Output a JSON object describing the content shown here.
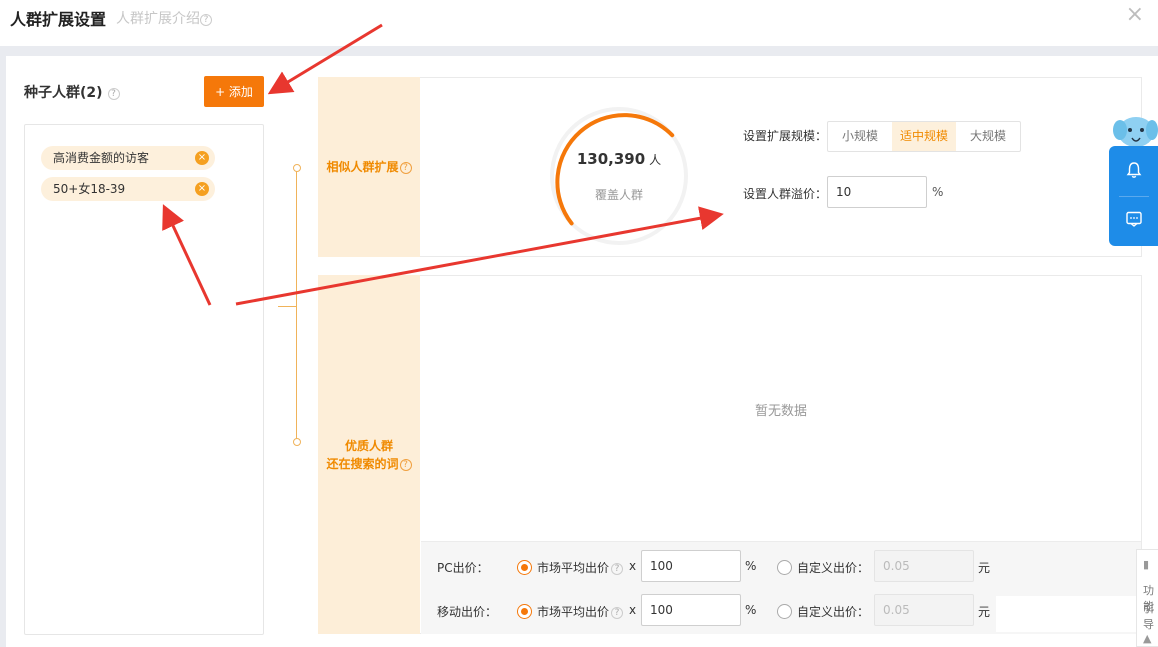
{
  "header": {
    "title": "人群扩展设置",
    "subtitle": "人群扩展介绍",
    "close": "×"
  },
  "seed": {
    "title": "种子人群(2)",
    "add_button": "+ 添加",
    "tags": [
      {
        "label": "高消费金额的访客"
      },
      {
        "label": "50+女18-39"
      }
    ]
  },
  "similar": {
    "label": "相似人群扩展",
    "count": "130,390",
    "count_unit": "人",
    "count_label": "覆盖人群",
    "scale_label": "设置扩展规模：",
    "scale_options": [
      "小规模",
      "适中规模",
      "大规模"
    ],
    "scale_selected": "适中规模",
    "premium_label": "设置人群溢价：",
    "premium_value": "10",
    "premium_unit": "%"
  },
  "quality": {
    "label_line1": "优质人群",
    "label_line2": "还在搜索的词",
    "empty_text": "暂无数据"
  },
  "bids": {
    "pc_label": "PC出价：",
    "mobile_label": "移动出价：",
    "market_option": "市场平均出价",
    "times": "x",
    "pc_value": "100",
    "mobile_value": "100",
    "pct": "%",
    "custom_option": "自定义出价：",
    "custom_value": "0.05",
    "yuan": "元"
  },
  "side_panel": {
    "line1": "功能",
    "line2": "引导"
  },
  "colors": {
    "accent": "#f5780a",
    "label_bg": "#fdeed8",
    "widget_blue": "#1e8ce8",
    "arrow_red": "#e8372f"
  },
  "icons": [
    "close-icon",
    "help-icon",
    "remove-tag-icon",
    "bell-icon",
    "chat-icon",
    "mascot-icon",
    "book-icon",
    "up-arrow-icon"
  ]
}
